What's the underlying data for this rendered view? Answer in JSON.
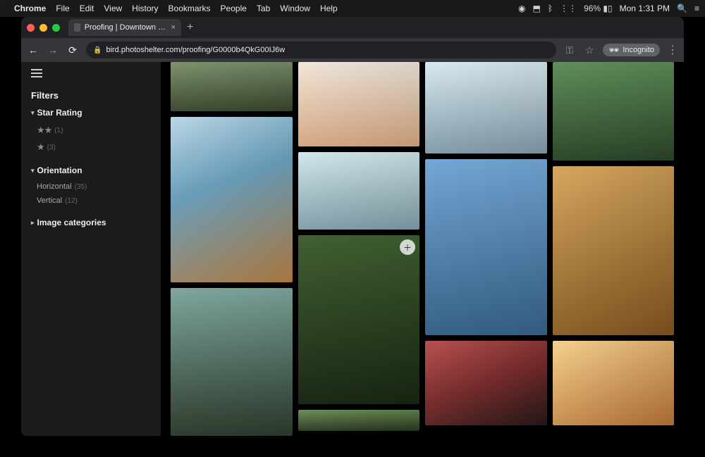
{
  "menubar": {
    "app": "Chrome",
    "items": [
      "File",
      "Edit",
      "View",
      "History",
      "Bookmarks",
      "People",
      "Tab",
      "Window",
      "Help"
    ],
    "battery": "96%",
    "day": "Mon",
    "time": "1:31 PM"
  },
  "chrome": {
    "tab_title": "Proofing | Downtown Grand Ra...",
    "url": "bird.photoshelter.com/proofing/G0000b4QkG00IJ6w",
    "incognito_label": "Incognito"
  },
  "sidebar": {
    "title": "Filters",
    "facets": {
      "star": {
        "label": "Star Rating",
        "two_star_count": "(1)",
        "one_star_count": "(3)"
      },
      "orientation": {
        "label": "Orientation",
        "horizontal_label": "Horizontal",
        "horizontal_count": "(35)",
        "vertical_label": "Vertical",
        "vertical_count": "(12)"
      },
      "categories": {
        "label": "Image categories"
      }
    }
  }
}
